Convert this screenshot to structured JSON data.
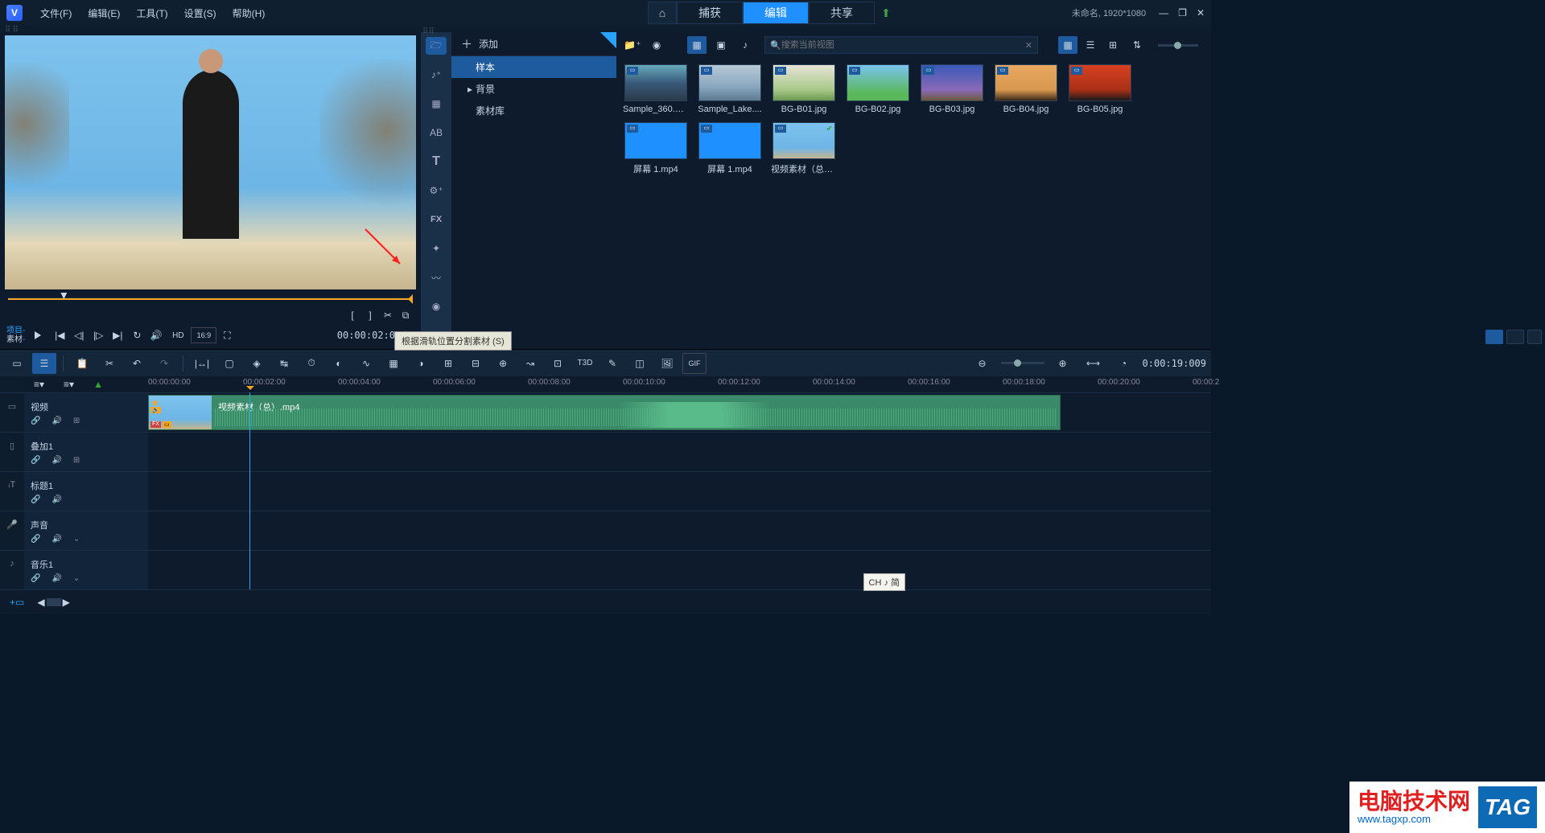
{
  "titlebar": {
    "menus": {
      "file": "文件(F)",
      "edit": "编辑(E)",
      "tools": "工具(T)",
      "settings": "设置(S)",
      "help": "帮助(H)"
    },
    "modes": {
      "capture": "捕获",
      "edit": "编辑",
      "share": "共享"
    },
    "project_info": "未命名, 1920*1080"
  },
  "preview": {
    "label_project": "项目",
    "label_material": "素材",
    "hd": "HD",
    "aspect": "16:9",
    "timecode": "00:00:02:0"
  },
  "tooltip": {
    "split": "根据滑轨位置分割素材 (S)"
  },
  "media": {
    "add": "添加",
    "tree": {
      "sample": "样本",
      "background": "背景",
      "library": "素材库"
    },
    "search_placeholder": "搜索当前视图",
    "items": [
      {
        "name": "Sample_360.m...",
        "bg": "linear-gradient(to bottom,#6ab 0%,#3a5a7a 50%,#2a3a4a 100%)"
      },
      {
        "name": "Sample_Lake....",
        "bg": "linear-gradient(to bottom,#b8c8d6 0%,#8aa8c0 60%,#5a7a90 100%)"
      },
      {
        "name": "BG-B01.jpg",
        "bg": "linear-gradient(to bottom,#e8e4d8 0%,#a8c888 70%,#6a9850 100%)"
      },
      {
        "name": "BG-B02.jpg",
        "bg": "linear-gradient(to bottom,#7ac3ee 0%,#5ab85a 80%)"
      },
      {
        "name": "BG-B03.jpg",
        "bg": "linear-gradient(to bottom,#3a5ab8 0%,#8a6ab8 70%,#6a5a3a 100%)"
      },
      {
        "name": "BG-B04.jpg",
        "bg": "linear-gradient(to bottom,#e8a860 0%,#d89850 70%,#3a2a1a 100%)"
      },
      {
        "name": "BG-B05.jpg",
        "bg": "linear-gradient(to bottom,#d84020 0%,#a83018 70%,#1a1a1a 100%)"
      },
      {
        "name": "屏幕 1.mp4",
        "bg": "#1e90ff"
      },
      {
        "name": "屏幕 1.mp4",
        "bg": "#1e90ff"
      },
      {
        "name": "视频素材（总）...",
        "bg": "linear-gradient(to bottom,#7ec3ee 0%,#6db5e5 70%,#c6b58e 100%)",
        "checked": true
      }
    ]
  },
  "timeline": {
    "current": "0:00:19:009",
    "ruler": [
      "00:00:00:00",
      "00:00:02:00",
      "00:00:04:00",
      "00:00:06:00",
      "00:00:08:00",
      "00:00:10:00",
      "00:00:12:00",
      "00:00:14:00",
      "00:00:16:00",
      "00:00:18:00",
      "00:00:20:00",
      "00:00:2"
    ],
    "tracks": {
      "video": "视频",
      "overlay": "叠加1",
      "title": "标题1",
      "voice": "声音",
      "music": "音乐1"
    },
    "clip_name": "视频素材（总）.mp4"
  },
  "vtools": {
    "fx": "FX",
    "t": "T",
    "ab": "AB",
    "t3d": "T3D"
  },
  "ime": "CH ♪ 简",
  "watermark": {
    "title": "电脑技术网",
    "url": "www.tagxp.com",
    "tag": "TAG"
  }
}
